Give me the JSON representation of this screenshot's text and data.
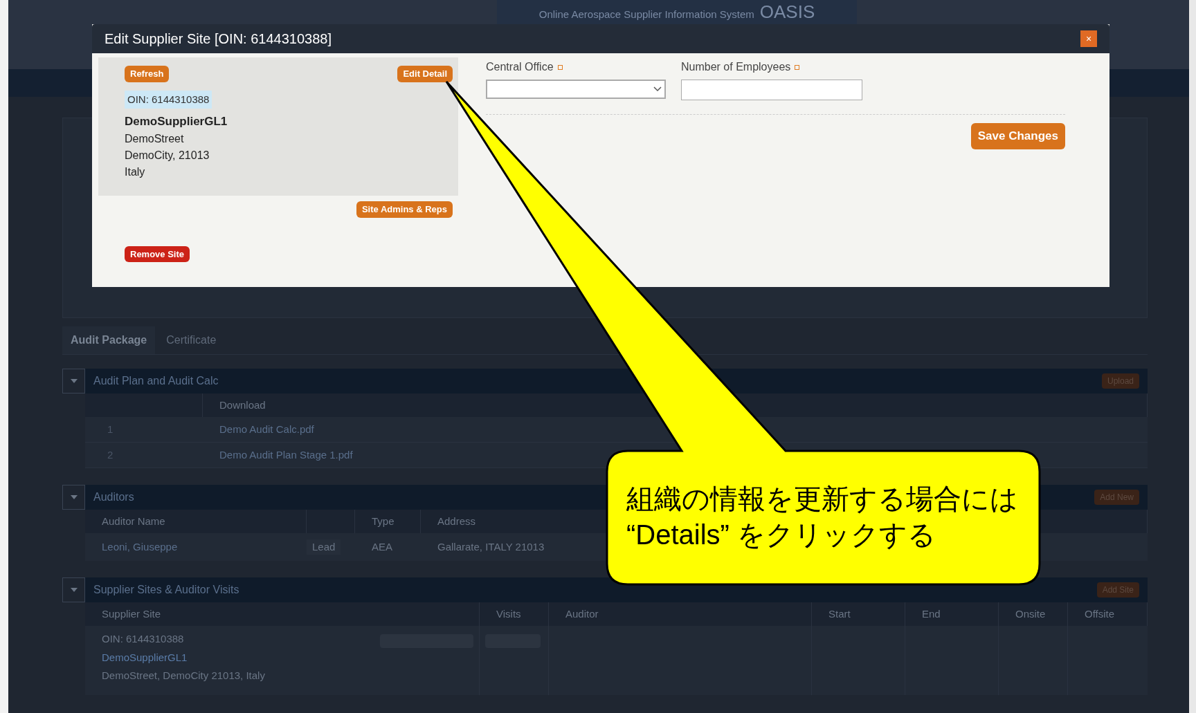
{
  "header": {
    "title": "Online Aerospace Supplier Information System",
    "logo": "OASIS"
  },
  "tabs": [
    {
      "label": "Audit Package",
      "selected": true
    },
    {
      "label": "Certificate",
      "selected": false
    }
  ],
  "sections": [
    {
      "kind": "files",
      "title": "Audit Plan and Audit Calc",
      "action": "Upload",
      "columns": [
        "",
        "Download"
      ],
      "rows": [
        [
          "1",
          "Demo Audit Calc.pdf"
        ],
        [
          "2",
          "Demo Audit Plan Stage 1.pdf"
        ]
      ]
    },
    {
      "kind": "auditors",
      "title": "Auditors",
      "action": "Add New",
      "columns": [
        "Auditor Name",
        "",
        "Type",
        "Address"
      ],
      "rows": [
        [
          "Leoni, Giuseppe",
          "Lead",
          "AEA",
          "Gallarate, ITALY 21013"
        ]
      ]
    },
    {
      "kind": "sites",
      "title": "Supplier Sites & Auditor Visits",
      "action": "Add Site",
      "columns": [
        "Supplier Site",
        "Visits",
        "Auditor",
        "Start",
        "End",
        "Onsite",
        "Offsite"
      ],
      "rows": [
        {
          "oin": "OIN: 6144310388",
          "name": "DemoSupplierGL1",
          "address": "DemoStreet, DemoCity 21013, Italy"
        }
      ]
    }
  ],
  "modal": {
    "title": "Edit Supplier Site [OIN: 6144310388]",
    "close": "×",
    "refresh": "Refresh",
    "edit_detail": "Edit Detail",
    "oin": "OIN: 6144310388",
    "name": "DemoSupplierGL1",
    "address_lines": [
      "DemoStreet",
      "DemoCity, 21013",
      "Italy"
    ],
    "site_admins": "Site Admins & Reps",
    "remove_site": "Remove Site",
    "fields": [
      {
        "label": "Central Office",
        "kind": "select",
        "required": true
      },
      {
        "label": "Number of Employees",
        "kind": "text",
        "required": true
      }
    ],
    "save": "Save Changes"
  },
  "callout": {
    "lines": [
      "組織の情報を更新する場合には",
      "“Details” をクリックする"
    ]
  }
}
